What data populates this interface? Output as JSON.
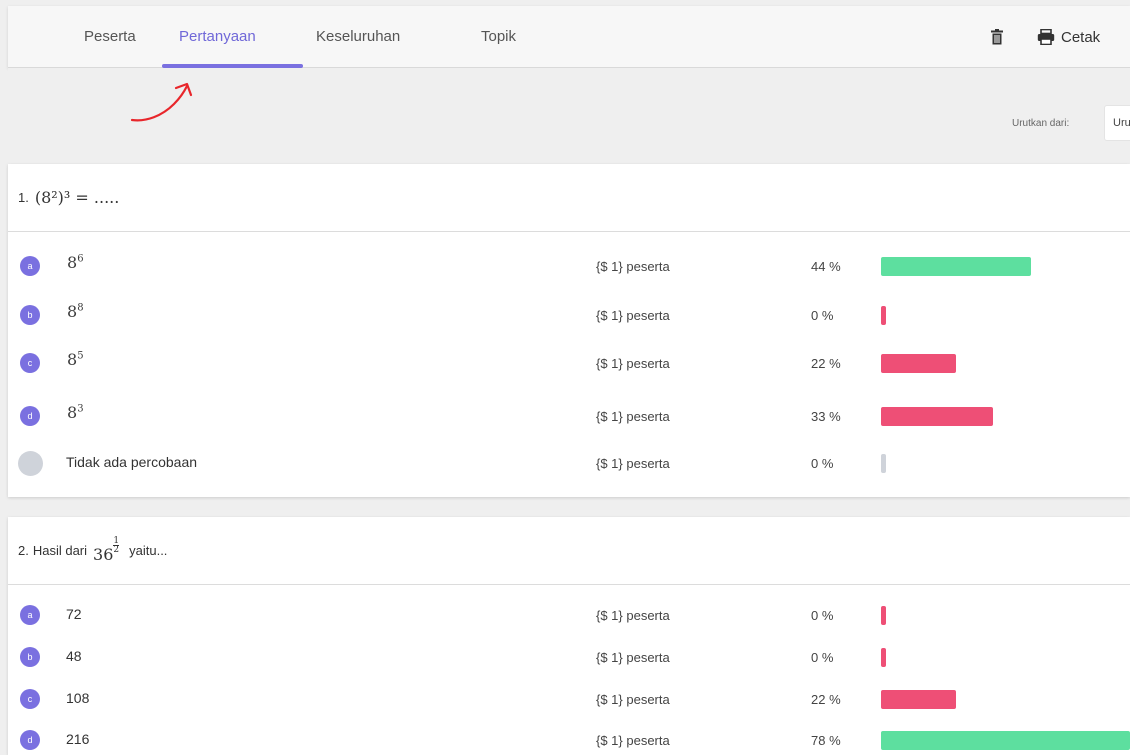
{
  "tabs": [
    {
      "label": "Peserta",
      "active": false
    },
    {
      "label": "Pertanyaan",
      "active": true
    },
    {
      "label": "Keseluruhan",
      "active": false
    },
    {
      "label": "Topik",
      "active": false
    }
  ],
  "toolbar": {
    "delete_icon": "trash-icon",
    "print_icon": "printer-icon",
    "print_label": "Cetak"
  },
  "sort": {
    "label": "Urutkan dari:",
    "selected": "Urutkan"
  },
  "colors": {
    "accent": "#7a70e0",
    "correct": "#5ddf9f",
    "wrong": "#ee4f76",
    "none": "#cfd3da"
  },
  "questions": [
    {
      "number": "1.",
      "text_math": "(8²)³ = .....",
      "options": [
        {
          "letter": "a",
          "math_base": "8",
          "math_exp": "6",
          "count": "{$ 1} peserta",
          "percent_label": "44 %",
          "percent": 44,
          "status": "correct"
        },
        {
          "letter": "b",
          "math_base": "8",
          "math_exp": "8",
          "count": "{$ 1} peserta",
          "percent_label": "0 %",
          "percent": 0,
          "status": "wrong"
        },
        {
          "letter": "c",
          "math_base": "8",
          "math_exp": "5",
          "count": "{$ 1} peserta",
          "percent_label": "22 %",
          "percent": 22,
          "status": "wrong"
        },
        {
          "letter": "d",
          "math_base": "8",
          "math_exp": "3",
          "count": "{$ 1} peserta",
          "percent_label": "33 %",
          "percent": 33,
          "status": "wrong"
        },
        {
          "letter": "",
          "text": "Tidak ada percobaan",
          "count": "{$ 1} peserta",
          "percent_label": "0 %",
          "percent": 0,
          "status": "none"
        }
      ]
    },
    {
      "number": "2.",
      "prefix": "Hasil dari",
      "math_base": "36",
      "math_exp_num": "1",
      "math_exp_den": "2",
      "suffix": "yaitu...",
      "options": [
        {
          "letter": "a",
          "text": "72",
          "count": "{$ 1} peserta",
          "percent_label": "0 %",
          "percent": 0,
          "status": "wrong"
        },
        {
          "letter": "b",
          "text": "48",
          "count": "{$ 1} peserta",
          "percent_label": "0 %",
          "percent": 0,
          "status": "wrong"
        },
        {
          "letter": "c",
          "text": "108",
          "count": "{$ 1} peserta",
          "percent_label": "22 %",
          "percent": 22,
          "status": "wrong"
        },
        {
          "letter": "d",
          "text": "216",
          "count": "{$ 1} peserta",
          "percent_label": "78 %",
          "percent": 78,
          "status": "correct"
        }
      ]
    }
  ]
}
